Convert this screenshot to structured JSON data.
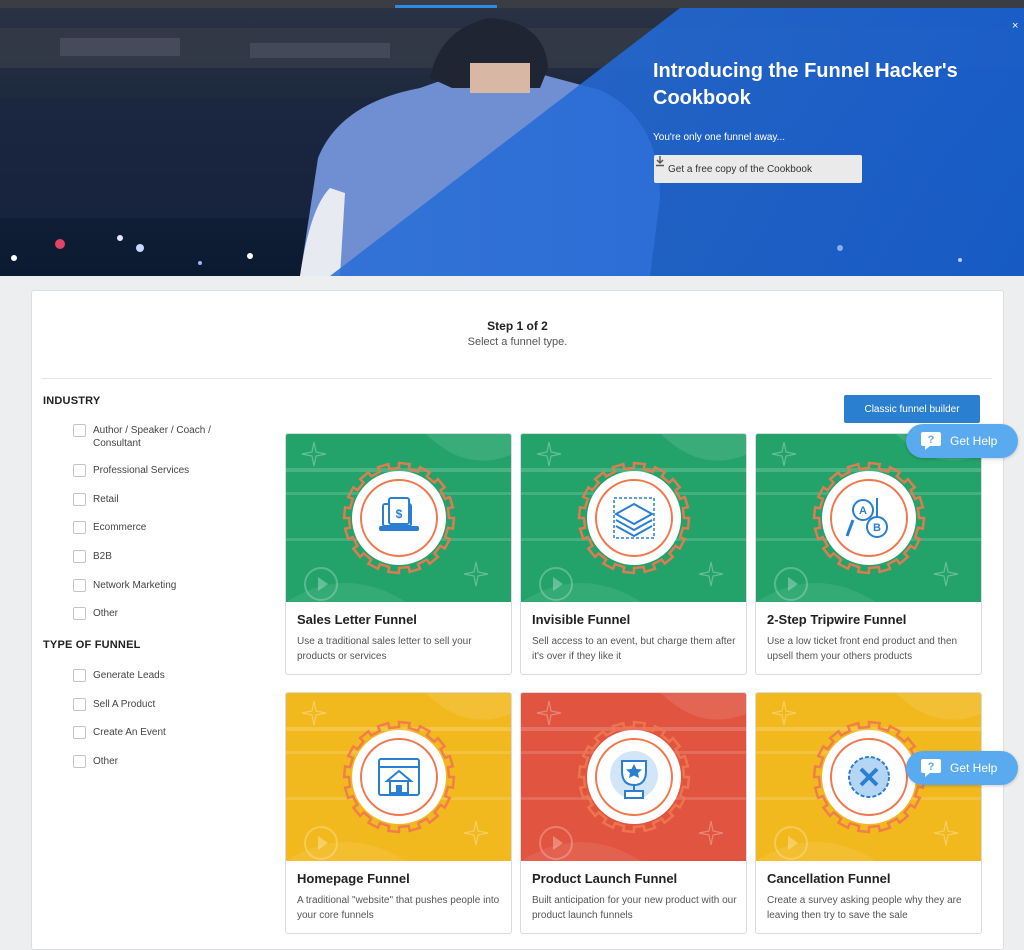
{
  "hero": {
    "title": "Introducing the Funnel Hacker's Cookbook",
    "subtitle": "You're only one funnel away...",
    "button_label": "Get a free copy of the Cookbook",
    "close_label": "×"
  },
  "step": {
    "title": "Step 1 of 2",
    "subtitle": "Select a funnel type."
  },
  "filters": {
    "industry_heading": "INDUSTRY",
    "industry": [
      "Author / Speaker / Coach / Consultant",
      "Professional Services",
      "Retail",
      "Ecommerce",
      "B2B",
      "Network Marketing",
      "Other"
    ],
    "type_heading": "TYPE OF FUNNEL",
    "type": [
      "Generate Leads",
      "Sell A Product",
      "Create An Event",
      "Other"
    ]
  },
  "classic_button": "Classic funnel builder",
  "get_help": "Get Help",
  "cards": [
    {
      "title": "Sales Letter Funnel",
      "desc": "Use a traditional sales letter to sell your products or services",
      "color": "#23a36a",
      "icon": "sales-letter-icon"
    },
    {
      "title": "Invisible Funnel",
      "desc": "Sell access to an event, but charge them after it's over if they like it",
      "color": "#23a36a",
      "icon": "layers-icon"
    },
    {
      "title": "2-Step Tripwire Funnel",
      "desc": "Use a low ticket front end product and then upsell them your others products",
      "color": "#23a36a",
      "icon": "ab-test-icon"
    },
    {
      "title": "Homepage Funnel",
      "desc": "A traditional \"website\" that pushes people into your core funnels",
      "color": "#f2b91f",
      "icon": "homepage-icon"
    },
    {
      "title": "Product Launch Funnel",
      "desc": "Built anticipation for your new product with our product launch funnels",
      "color": "#e05440",
      "icon": "trophy-icon"
    },
    {
      "title": "Cancellation Funnel",
      "desc": "Create a survey asking people why they are leaving then try to save the sale",
      "color": "#f2b91f",
      "icon": "cancel-icon"
    }
  ]
}
